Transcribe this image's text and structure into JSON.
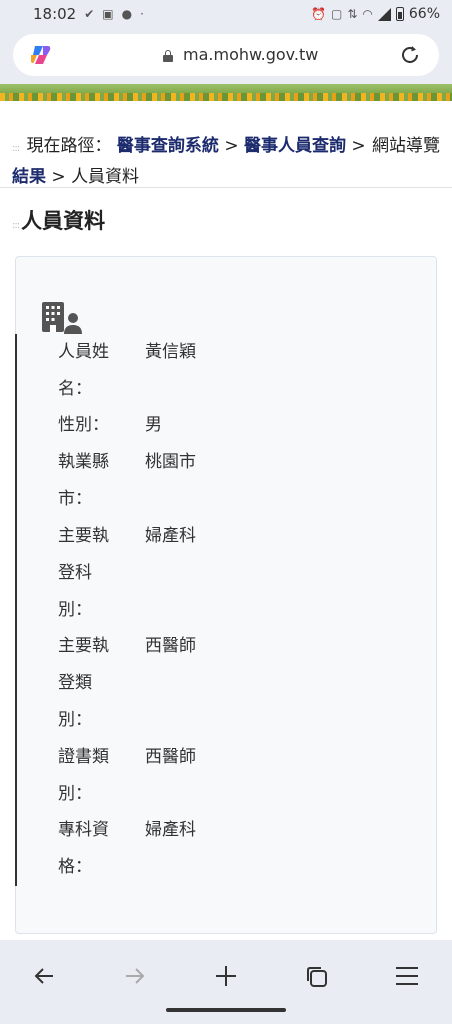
{
  "status_bar": {
    "time": "18:02",
    "battery": "66%"
  },
  "browser": {
    "url": "ma.mohw.gov.tw"
  },
  "breadcrumb": {
    "prefix": "現在路徑：",
    "items": [
      "醫事查詢系統",
      "醫事人員查詢",
      "人員查詢結果"
    ],
    "current": "人員資料",
    "separator": " > "
  },
  "site_nav": "網站導覽",
  "page_title": "人員資料",
  "person": {
    "rows": [
      {
        "label": "人員姓名：",
        "value": "黃信穎"
      },
      {
        "label": "性別：",
        "value": "男"
      },
      {
        "label": "執業縣市：",
        "value": "桃園市"
      },
      {
        "label": "主要執登科別：",
        "value": "婦產科"
      },
      {
        "label": "主要執登類別：",
        "value": "西醫師"
      },
      {
        "label": "證書類別：",
        "value": "西醫師"
      },
      {
        "label": "專科資格：",
        "value": "婦產科"
      }
    ]
  },
  "icons": [
    "copilot-icon",
    "lock-icon",
    "reload-icon",
    "org-person-icon",
    "back-icon",
    "forward-icon",
    "new-tab-icon",
    "tabs-icon",
    "menu-icon"
  ],
  "colors": {
    "link": "#1c2b6e",
    "chrome_bg": "#e9ecf3",
    "card_bg": "#f8f9fb"
  }
}
